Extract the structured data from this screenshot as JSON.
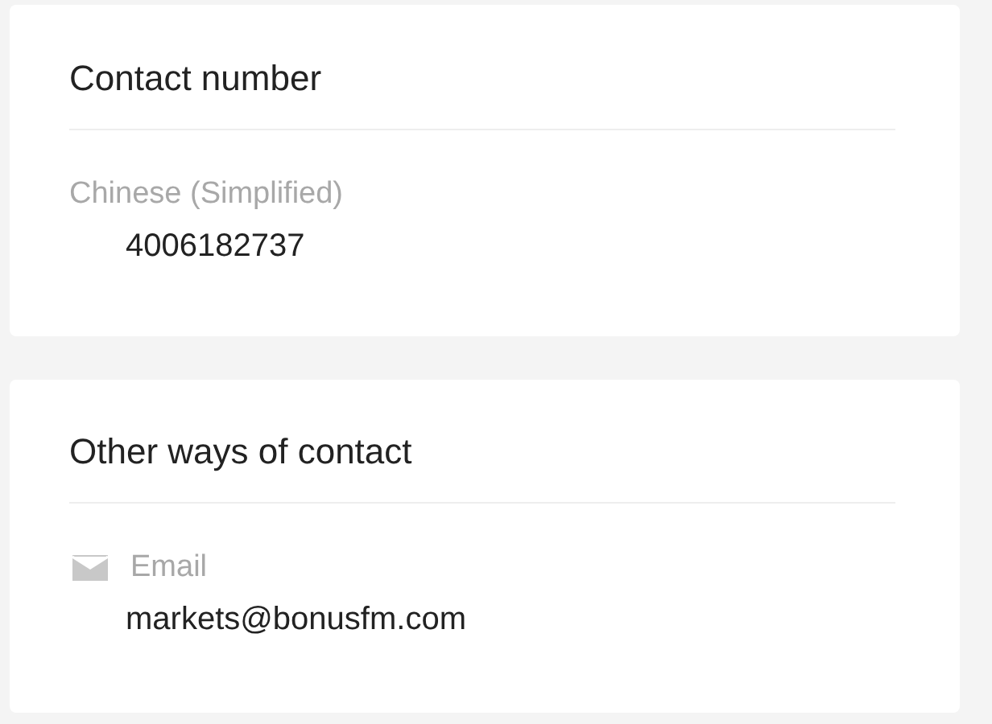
{
  "sections": [
    {
      "title": "Contact number",
      "items": [
        {
          "kind": "phone",
          "label": "Chinese (Simplified)",
          "value": "4006182737"
        }
      ]
    },
    {
      "title": "Other ways of contact",
      "items": [
        {
          "kind": "email",
          "label": "Email",
          "value": "markets@bonusfm.com"
        }
      ]
    }
  ]
}
